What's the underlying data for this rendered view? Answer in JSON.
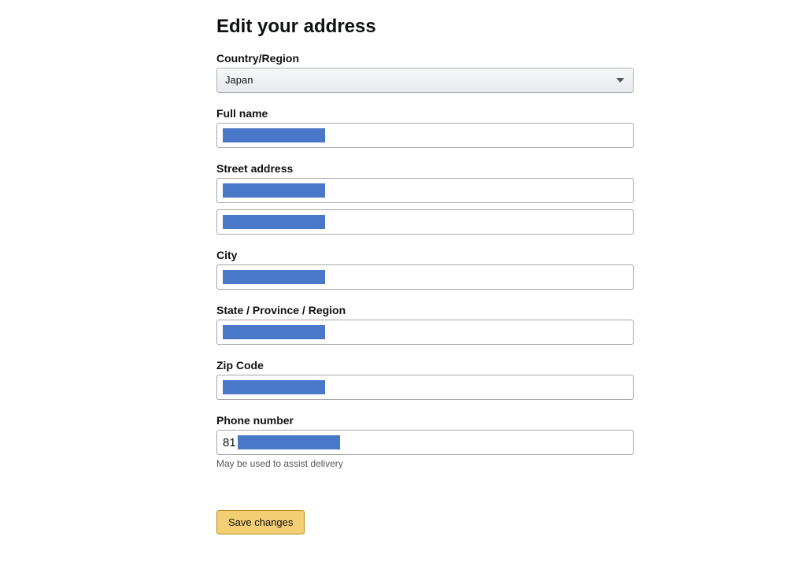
{
  "page": {
    "title": "Edit your address"
  },
  "form": {
    "country_label": "Country/Region",
    "country_value": "Japan",
    "full_name_label": "Full name",
    "street_label": "Street address",
    "city_label": "City",
    "state_label": "State / Province / Region",
    "zip_label": "Zip Code",
    "phone_label": "Phone number",
    "phone_prefix": "81",
    "phone_hint": "May be used to assist delivery",
    "save_label": "Save changes"
  }
}
